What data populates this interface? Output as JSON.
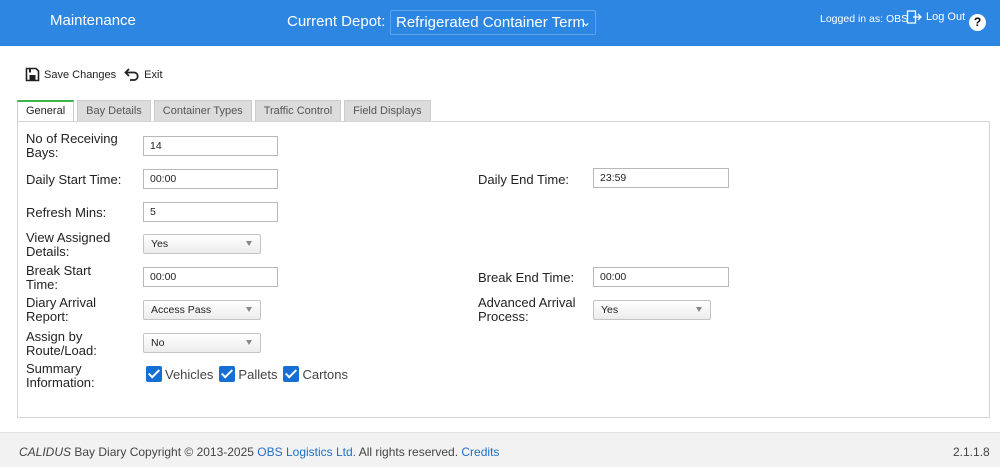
{
  "header": {
    "app_title": "Maintenance",
    "depot_label": "Current Depot:",
    "depot_value": "Refrigerated Container Term",
    "login_text": "Logged in as: OBS",
    "logout_label": "Log Out",
    "help_label": "?"
  },
  "toolbar": {
    "save_label": "Save Changes",
    "exit_label": "Exit"
  },
  "tabs": [
    "General",
    "Bay Details",
    "Container Types",
    "Traffic Control",
    "Field Displays"
  ],
  "form": {
    "receiving_bays": {
      "label1": "No of Receiving",
      "label2": "Bays:",
      "value": "14"
    },
    "start_time": {
      "label": "Daily Start Time:",
      "value": "00:00"
    },
    "end_time": {
      "label": "Daily End Time:",
      "value": "23:59"
    },
    "refresh": {
      "label": "Refresh Mins:",
      "value": "5"
    },
    "view_assigned": {
      "label1": "View Assigned",
      "label2": "Details:",
      "value": "Yes"
    },
    "break_start": {
      "label1": "Break Start",
      "label2": "Time:",
      "value": "00:00"
    },
    "break_end": {
      "label": "Break End Time:",
      "value": "00:00"
    },
    "diary_arrival": {
      "label1": "Diary Arrival",
      "label2": "Report:",
      "value": "Access Pass"
    },
    "advanced_arrival": {
      "label1": "Advanced Arrival",
      "label2": "Process:",
      "value": "Yes"
    },
    "assign_by": {
      "label1": "Assign by",
      "label2": "Route/Load:",
      "value": "No"
    },
    "summary": {
      "label1": "Summary",
      "label2": "Information:",
      "options": [
        "Vehicles",
        "Pallets",
        "Cartons"
      ]
    }
  },
  "footer": {
    "brand": "CALIDUS",
    "text1": " Bay Diary Copyright © 2013-2025 ",
    "company": "OBS Logistics Ltd.",
    "text2": " All rights reserved. ",
    "credits": "Credits",
    "version": "2.1.1.8"
  },
  "colors": {
    "header": "#2d87e2",
    "active_tab": "#3bb54a",
    "checkbox": "#1670d4"
  }
}
